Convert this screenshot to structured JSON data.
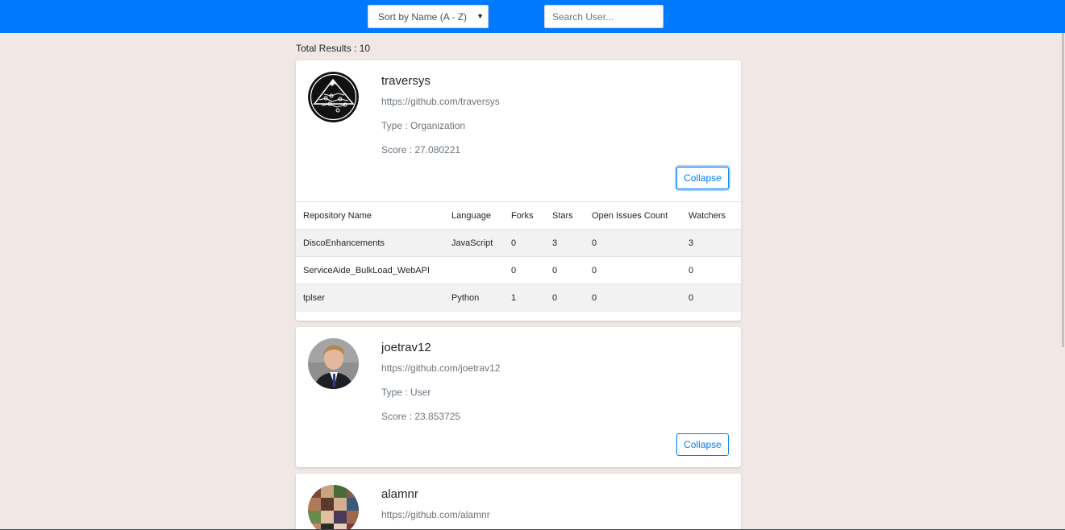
{
  "header": {
    "sort_label": "Sort by Name (A - Z)",
    "search_placeholder": "Search User..."
  },
  "total_results": "Total Results : 10",
  "users": [
    {
      "name": "traversys",
      "url": "https://github.com/traversys",
      "type": "Type : Organization",
      "score": "Score : 27.080221",
      "button": "Collapse",
      "avatar": "mountain-logo-avatar",
      "repo_headers": [
        "Repository Name",
        "Language",
        "Forks",
        "Stars",
        "Open Issues Count",
        "Watchers"
      ],
      "repos": [
        [
          "DiscoEnhancements",
          "JavaScript",
          "0",
          "3",
          "0",
          "3"
        ],
        [
          "ServiceAide_BulkLoad_WebAPI",
          "",
          "0",
          "0",
          "0",
          "0"
        ],
        [
          "tplser",
          "Python",
          "1",
          "0",
          "0",
          "0"
        ]
      ]
    },
    {
      "name": "joetrav12",
      "url": "https://github.com/joetrav12",
      "type": "Type : User",
      "score": "Score : 23.853725",
      "button": "Collapse",
      "avatar": "person-photo-avatar"
    },
    {
      "name": "alamnr",
      "url": "https://github.com/alamnr",
      "avatar": "photo-collage-avatar"
    }
  ],
  "colors": {
    "accent": "#007bff",
    "background": "#f1e8e6"
  }
}
